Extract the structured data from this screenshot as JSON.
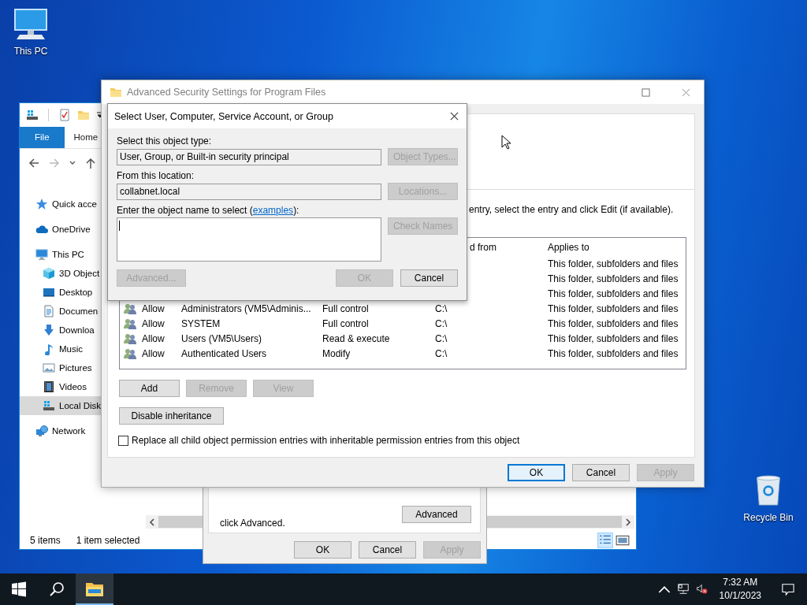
{
  "desktop_icons": [
    {
      "label": "This PC",
      "kind": "pc"
    },
    {
      "label": "Recycle Bin",
      "kind": "bin"
    }
  ],
  "explorer": {
    "ribbon_tabs": [
      {
        "label": "File",
        "selected": true
      },
      {
        "label": "Home",
        "selected": false
      }
    ],
    "nav_pane": [
      {
        "label": "Quick acce",
        "kind": "star",
        "selected": false
      },
      {
        "label": "OneDrive",
        "kind": "cloud",
        "selected": false
      },
      {
        "label": "This PC",
        "kind": "pc",
        "selected": false,
        "children": [
          {
            "label": "3D Object",
            "kind": "cube",
            "selected": false
          },
          {
            "label": "Desktop",
            "kind": "desktop",
            "selected": false
          },
          {
            "label": "Documen",
            "kind": "document",
            "selected": false
          },
          {
            "label": "Downloa",
            "kind": "download",
            "selected": false
          },
          {
            "label": "Music",
            "kind": "music",
            "selected": false
          },
          {
            "label": "Pictures",
            "kind": "pictures",
            "selected": false
          },
          {
            "label": "Videos",
            "kind": "videos",
            "selected": false
          },
          {
            "label": "Local Disk",
            "kind": "drive",
            "selected": true
          }
        ]
      },
      {
        "label": "Network",
        "kind": "network",
        "selected": false
      }
    ],
    "status_bar": {
      "item_count": "5 items",
      "selection": "1 item selected"
    }
  },
  "properties": {
    "note": "click Advanced.",
    "advanced_button": "Advanced",
    "buttons": [
      {
        "label": "OK",
        "disabled": false
      },
      {
        "label": "Cancel",
        "disabled": false
      },
      {
        "label": "Apply",
        "disabled": true
      }
    ]
  },
  "advanced_security": {
    "title": "Advanced Security Settings for Program Files",
    "instruction": "entry, select the entry and click Edit (if available).",
    "table": {
      "columns": [
        {
          "label": "d from"
        },
        {
          "label": "Applies to"
        }
      ],
      "rows": [
        {
          "applies_to": "This folder, subfolders and files"
        },
        {
          "applies_to": "This folder, subfolders and files"
        },
        {
          "applies_to": "This folder, subfolders and files"
        },
        {
          "type": "Allow",
          "principal": "Administrators (VM5\\Adminis...",
          "access": "Full control",
          "inherited_from": "C:\\",
          "applies_to": "This folder, subfolders and files"
        },
        {
          "type": "Allow",
          "principal": "SYSTEM",
          "access": "Full control",
          "inherited_from": "C:\\",
          "applies_to": "This folder, subfolders and files"
        },
        {
          "type": "Allow",
          "principal": "Users (VM5\\Users)",
          "access": "Read & execute",
          "inherited_from": "C:\\",
          "applies_to": "This folder, subfolders and files"
        },
        {
          "type": "Allow",
          "principal": "Authenticated Users",
          "access": "Modify",
          "inherited_from": "C:\\",
          "applies_to": "This folder, subfolders and files"
        }
      ]
    },
    "entry_buttons": [
      {
        "label": "Add",
        "disabled": false
      },
      {
        "label": "Remove",
        "disabled": true
      },
      {
        "label": "View",
        "disabled": true
      }
    ],
    "inheritance_button": "Disable inheritance",
    "replace_option": {
      "label": "Replace all child object permission entries with inheritable permission entries from this object",
      "checked": false
    },
    "buttons": [
      {
        "label": "OK",
        "disabled": false,
        "focused": true
      },
      {
        "label": "Cancel",
        "disabled": false,
        "focused": false
      },
      {
        "label": "Apply",
        "disabled": true,
        "focused": false
      }
    ]
  },
  "select_dialog": {
    "title": "Select User, Computer, Service Account, or Group",
    "object_type_label": "Select this object type:",
    "object_type": "User, Group, or Built-in security principal",
    "object_types_button": "Object Types...",
    "location_label": "From this location:",
    "location": "collabnet.local",
    "locations_button": "Locations...",
    "name_label": "Enter the object name to select (",
    "name_link": "examples",
    "name_label_end": "):",
    "check_names_button": "Check Names",
    "buttons": [
      {
        "label": "Advanced...",
        "disabled": true
      },
      {
        "label": "OK",
        "disabled": true
      },
      {
        "label": "Cancel",
        "disabled": false
      }
    ]
  },
  "taskbar": {
    "pinned": [
      {
        "kind": "explorer",
        "active": true
      }
    ],
    "time": "7:32 AM",
    "date": "10/1/2023"
  }
}
